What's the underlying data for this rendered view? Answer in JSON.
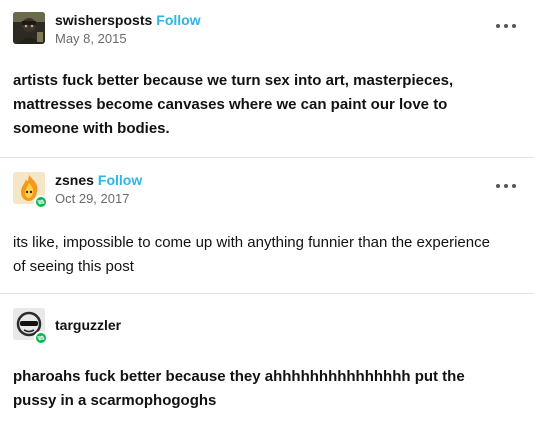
{
  "posts": [
    {
      "username": "swishersposts",
      "follow_label": "Follow",
      "date": "May 8, 2015",
      "text": "artists fuck better because we turn sex into art, masterpieces, mattresses become canvases where we can paint our love to someone with bodies.",
      "avatar": "avatar-photo",
      "has_more_menu": true
    },
    {
      "username": "zsnes",
      "follow_label": "Follow",
      "date": "Oct 29, 2017",
      "text": "its like, impossible to come up with anything funnier than the experience of seeing this post",
      "avatar": "avatar-flame",
      "has_reblog_badge": true,
      "has_more_menu": true
    },
    {
      "username": "targuzzler",
      "text": "pharoahs fuck better because they ahhhhhhhhhhhhhhh put the pussy in a scarmophogoghs",
      "avatar": "avatar-sunglasses",
      "has_reblog_badge": true
    }
  ],
  "icons": {
    "more": "more-horizontal-icon",
    "reblog": "reblog-icon"
  },
  "colors": {
    "follow": "#2fb4e8",
    "reblog_badge": "#00b84a",
    "divider": "#e3e3e3",
    "date": "#6b6b6b"
  }
}
